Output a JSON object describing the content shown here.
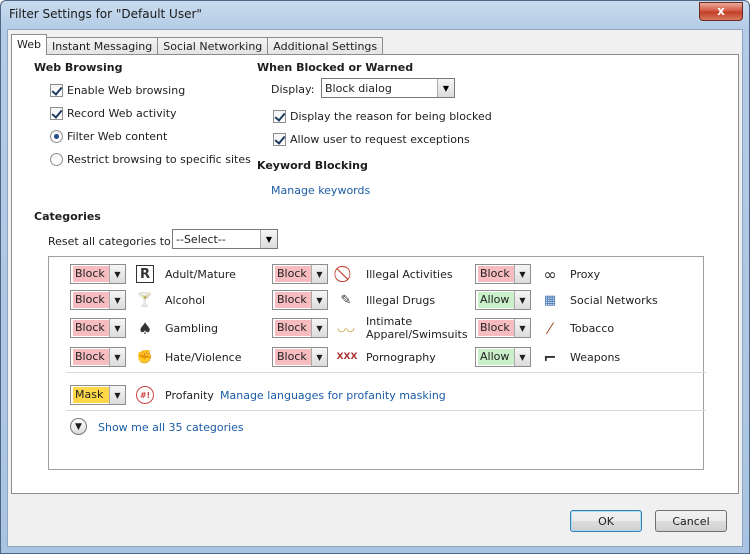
{
  "window": {
    "title": "Filter Settings for \"Default User\"",
    "close": "x"
  },
  "tabs": [
    "Web",
    "Instant Messaging",
    "Social Networking",
    "Additional Settings"
  ],
  "web_browsing": {
    "heading": "Web Browsing",
    "options": [
      {
        "label": "Enable Web browsing",
        "type": "checkbox",
        "checked": true
      },
      {
        "label": "Record Web activity",
        "type": "checkbox",
        "checked": true
      },
      {
        "label": "Filter Web content",
        "type": "radio",
        "checked": true
      },
      {
        "label": "Restrict browsing to specific sites",
        "type": "radio",
        "checked": false
      }
    ]
  },
  "blocked": {
    "heading": "When Blocked or Warned",
    "display_label": "Display:",
    "display_value": "Block dialog",
    "options": [
      {
        "label": "Display the reason for being blocked",
        "checked": true
      },
      {
        "label": "Allow user to request exceptions",
        "checked": true
      }
    ]
  },
  "keyword": {
    "heading": "Keyword Blocking",
    "link": "Manage keywords"
  },
  "categories": {
    "heading": "Categories",
    "reset_label": "Reset all categories to:",
    "reset_value": "--Select--",
    "items": [
      {
        "label": "Adult/Mature",
        "action": "Block",
        "icon": "R"
      },
      {
        "label": "Illegal Activities",
        "action": "Block",
        "icon": "⃠"
      },
      {
        "label": "Proxy",
        "action": "Block",
        "icon": "∞"
      },
      {
        "label": "Alcohol",
        "action": "Block",
        "icon": "🍸"
      },
      {
        "label": "Illegal Drugs",
        "action": "Block",
        "icon": "✎"
      },
      {
        "label": "Social Networks",
        "action": "Allow",
        "icon": "▦"
      },
      {
        "label": "Gambling",
        "action": "Block",
        "icon": "♠"
      },
      {
        "label": "Intimate Apparel/Swimsuits",
        "action": "Block",
        "icon": "◡◡"
      },
      {
        "label": "Tobacco",
        "action": "Block",
        "icon": "⁄"
      },
      {
        "label": "Hate/Violence",
        "action": "Block",
        "icon": "✊"
      },
      {
        "label": "Pornography",
        "action": "Block",
        "icon": "XXX"
      },
      {
        "label": "Weapons",
        "action": "Allow",
        "icon": "⌐"
      }
    ],
    "profanity": {
      "action": "Mask",
      "label": "Profanity",
      "icon": "#!",
      "link": "Manage languages for profanity masking"
    },
    "show_all": "Show me all 35 categories"
  },
  "buttons": {
    "ok": "OK",
    "cancel": "Cancel"
  },
  "colors": {
    "block": "#f6bcc0",
    "allow": "#c9f0c9",
    "mask": "#ffd84a",
    "link": "#1c5da6"
  }
}
